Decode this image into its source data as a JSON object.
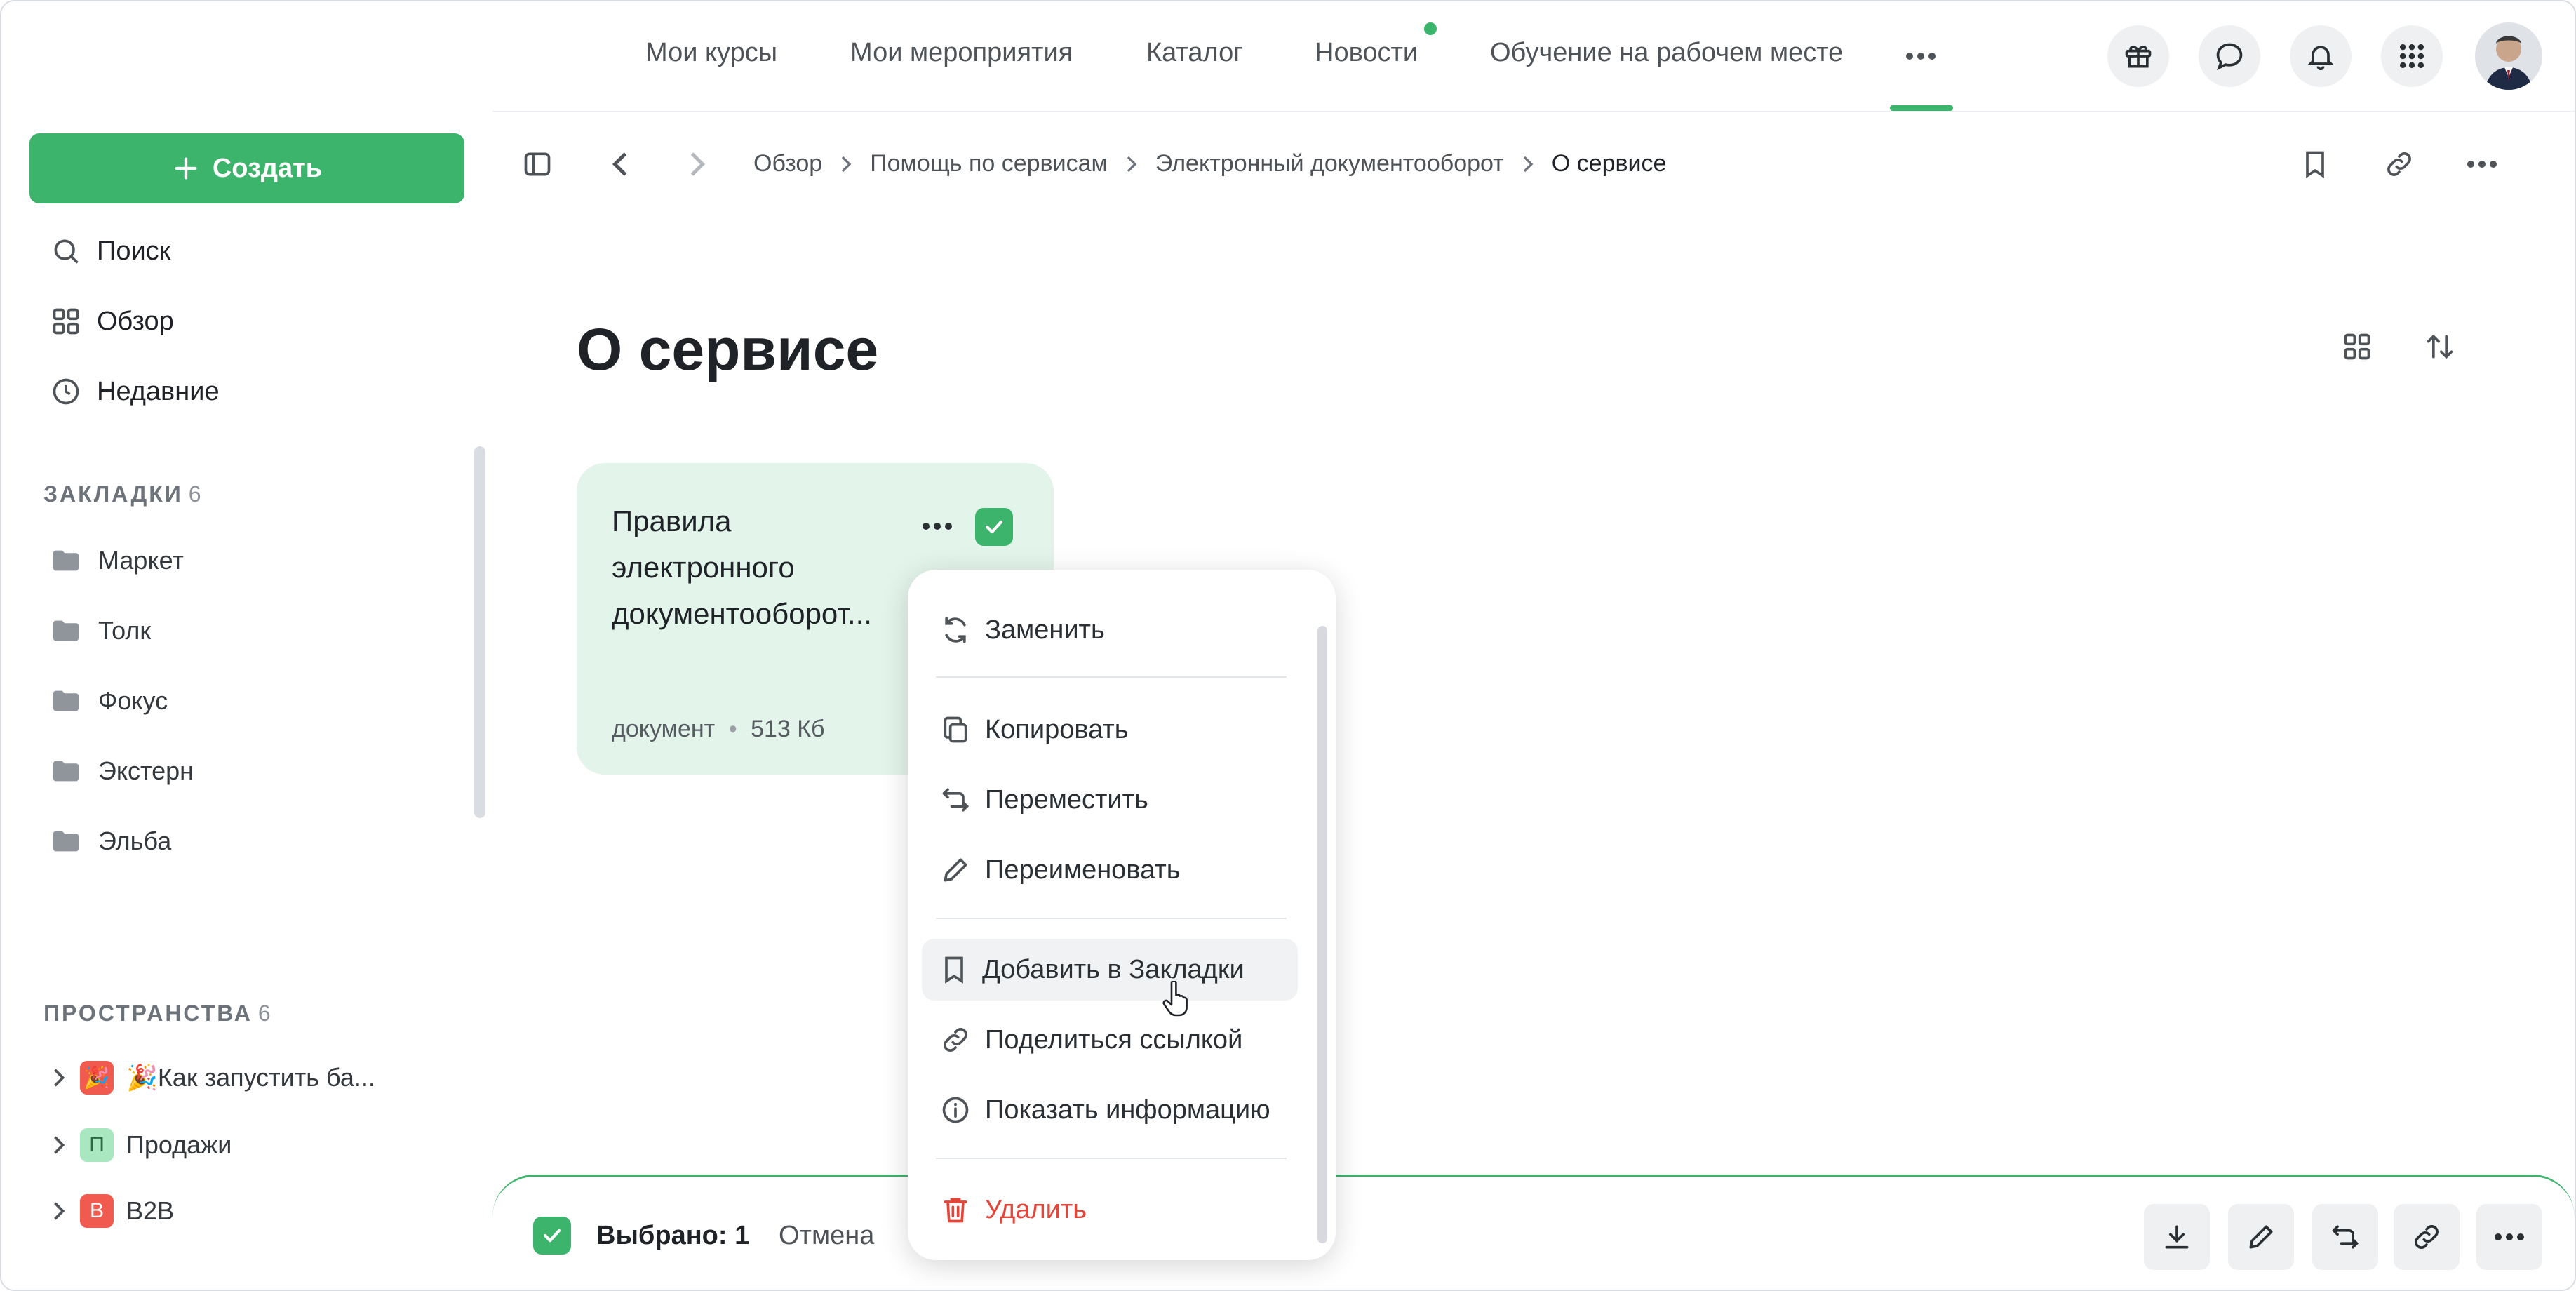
{
  "topnav": {
    "items": [
      "Мои курсы",
      "Мои мероприятия",
      "Каталог",
      "Новости",
      "Обучение на рабочем месте"
    ],
    "more_icon": "ellipsis-icon",
    "icons": [
      "gift-icon",
      "chat-icon",
      "bell-icon",
      "apps-grid-icon"
    ]
  },
  "sidebar": {
    "create_label": "Создать",
    "links": [
      "Поиск",
      "Обзор",
      "Недавние"
    ],
    "bookmarks": {
      "title": "ЗАКЛАДКИ",
      "count": "6",
      "items": [
        "Маркет",
        "Толк",
        "Фокус",
        "Экстерн",
        "Эльба"
      ]
    },
    "spaces": {
      "title": "ПРОСТРАНСТВА",
      "count": "6",
      "items": [
        {
          "badge": "🎉",
          "label": "🎉Как запустить ба...",
          "badge_color": "#f05a4f"
        },
        {
          "badge": "П",
          "label": "Продажи",
          "badge_color": "#a9e7c0"
        },
        {
          "badge": "B",
          "label": "B2B",
          "badge_color": "#f05a4f"
        }
      ]
    }
  },
  "breadcrumbs": {
    "items": [
      "Обзор",
      "Помощь по сервисам",
      "Электронный документооборот"
    ],
    "current": "О сервисе"
  },
  "page": {
    "title": "О сервисе"
  },
  "card": {
    "title": "Правила электронного документооборот...",
    "type": "документ",
    "size": "513 Кб",
    "selected": true
  },
  "context_menu": {
    "items": [
      "Заменить",
      "Копировать",
      "Переместить",
      "Переименовать",
      "Добавить в Закладки",
      "Поделиться ссылкой",
      "Показать информацию",
      "Удалить"
    ],
    "hovered": "Добавить в Закладки"
  },
  "selection_bar": {
    "selected_label": "Выбрано: 1",
    "cancel_label": "Отмена"
  },
  "colors": {
    "accent": "#3cb46c",
    "danger": "#e2463a",
    "card_bg": "#e3f4ea"
  }
}
